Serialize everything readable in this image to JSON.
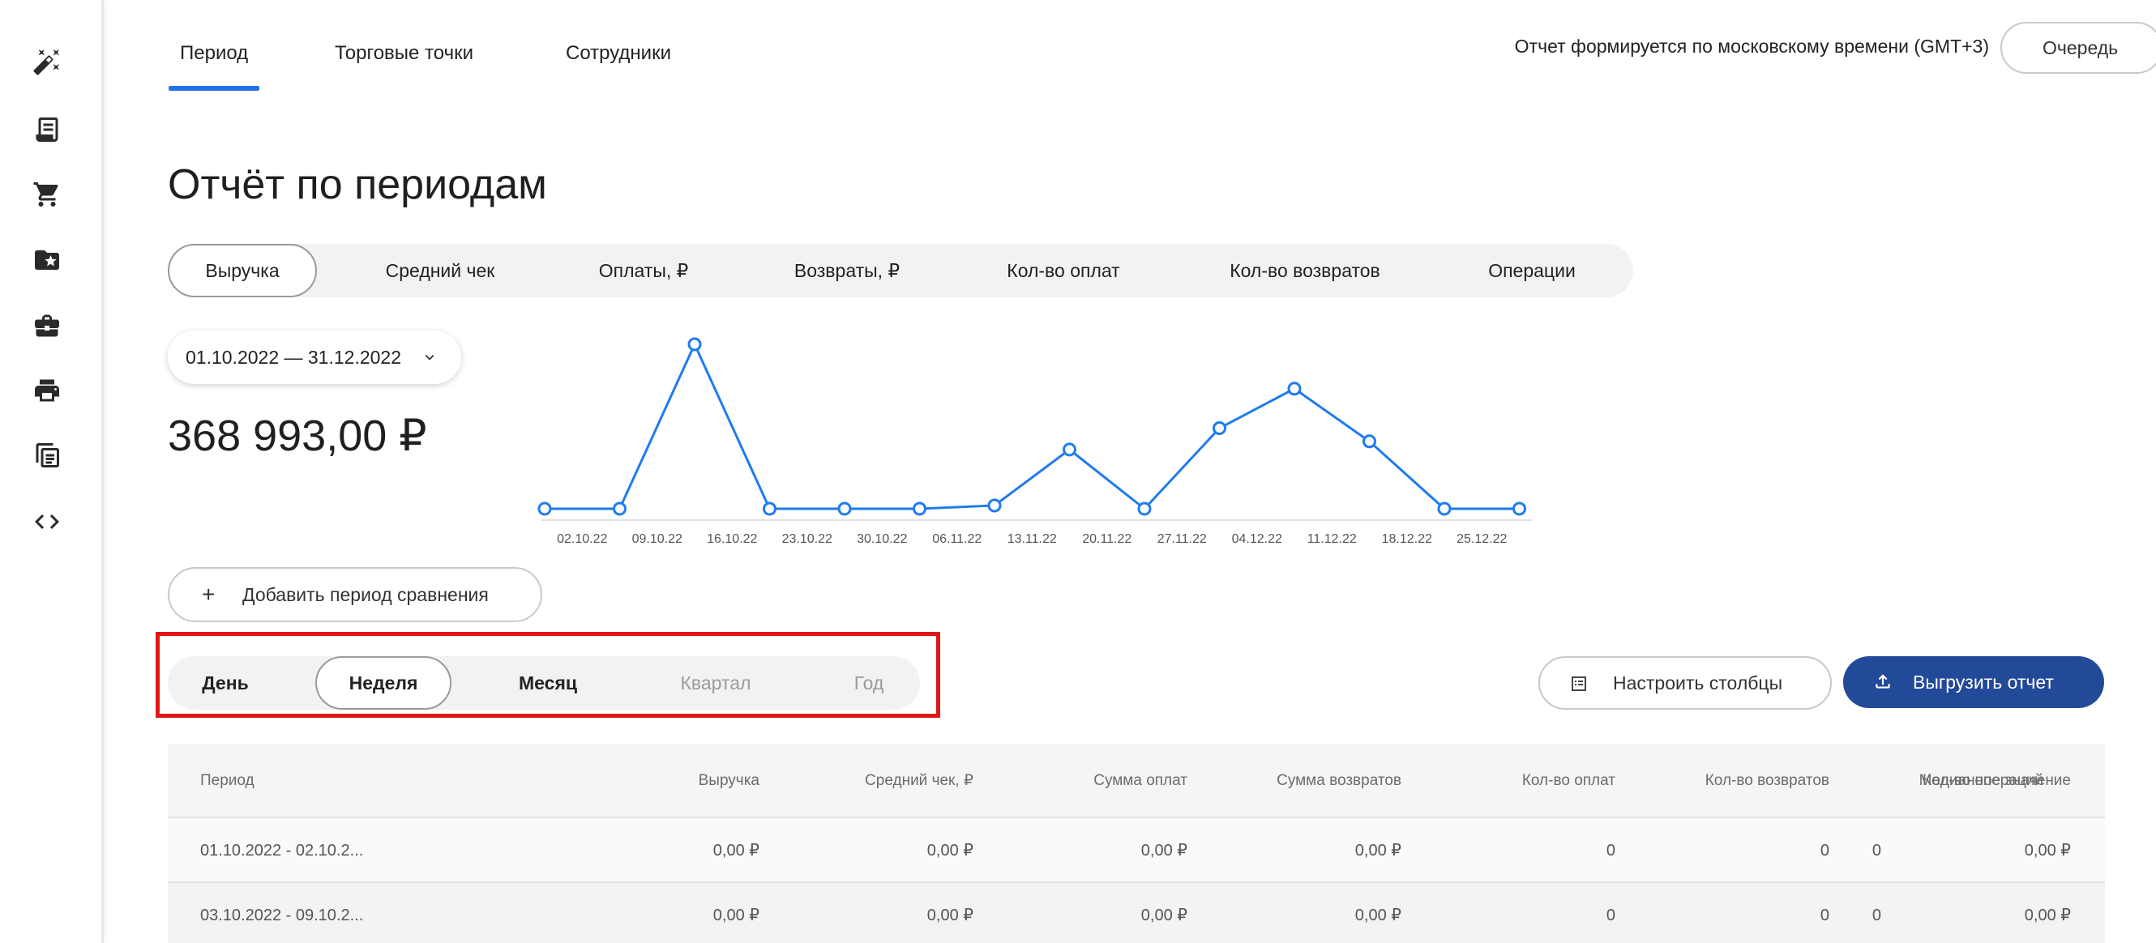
{
  "nav_tabs": [
    "Период",
    "Торговые точки",
    "Сотрудники"
  ],
  "timezone_note": "Отчет формируется по московскому времени (GMT+3)",
  "queue_label": "Очередь",
  "page_title": "Отчёт по периодам",
  "metric_tabs": [
    "Выручка",
    "Средний чек",
    "Оплаты, ₽",
    "Возвраты, ₽",
    "Кол-во оплат",
    "Кол-во возвратов",
    "Операции"
  ],
  "date_range": "01.10.2022 — 31.12.2022",
  "total_value": "368 993,00 ₽",
  "add_period_label": "Добавить период сравнения",
  "granularity_tabs": [
    "День",
    "Неделя",
    "Месяц",
    "Квартал",
    "Год"
  ],
  "configure_columns_label": "Настроить столбцы",
  "export_label": "Выгрузить отчет",
  "colors": {
    "accent": "#1e73e8",
    "export": "#234a98",
    "highlight": "#e01717"
  },
  "sidebar_icons": [
    "magic-wand-icon",
    "receipt-icon",
    "cart-icon",
    "folder-star-icon",
    "briefcase-icon",
    "printer-icon",
    "ledger-icon",
    "code-icon"
  ],
  "table": {
    "headers": [
      "Период",
      "Выручка",
      "Средний чек, ₽",
      "Сумма оплат",
      "Сумма возвратов",
      "Кол-во оплат",
      "Кол-во возвратов",
      "Кол-во операций",
      "Медианное значение"
    ],
    "rows": [
      [
        "01.10.2022 - 02.10.2...",
        "0,00 ₽",
        "0,00 ₽",
        "0,00 ₽",
        "0,00 ₽",
        "0",
        "0",
        "0",
        "0,00 ₽"
      ],
      [
        "03.10.2022 - 09.10.2...",
        "0,00 ₽",
        "0,00 ₽",
        "0,00 ₽",
        "0,00 ₽",
        "0",
        "0",
        "0",
        "0,00 ₽"
      ]
    ]
  },
  "chart_data": {
    "type": "line",
    "categories": [
      "02.10.22",
      "09.10.22",
      "16.10.22",
      "23.10.22",
      "30.10.22",
      "06.11.22",
      "13.11.22",
      "20.11.22",
      "27.11.22",
      "04.12.22",
      "11.12.22",
      "18.12.22",
      "25.12.22"
    ],
    "values": [
      0,
      0,
      100,
      0,
      0,
      0,
      2,
      36,
      0,
      49,
      73,
      41,
      0,
      0
    ],
    "value_unit": "relative (no y-axis shown)",
    "ylim": [
      0,
      100
    ],
    "grid": false,
    "legend": "none"
  }
}
